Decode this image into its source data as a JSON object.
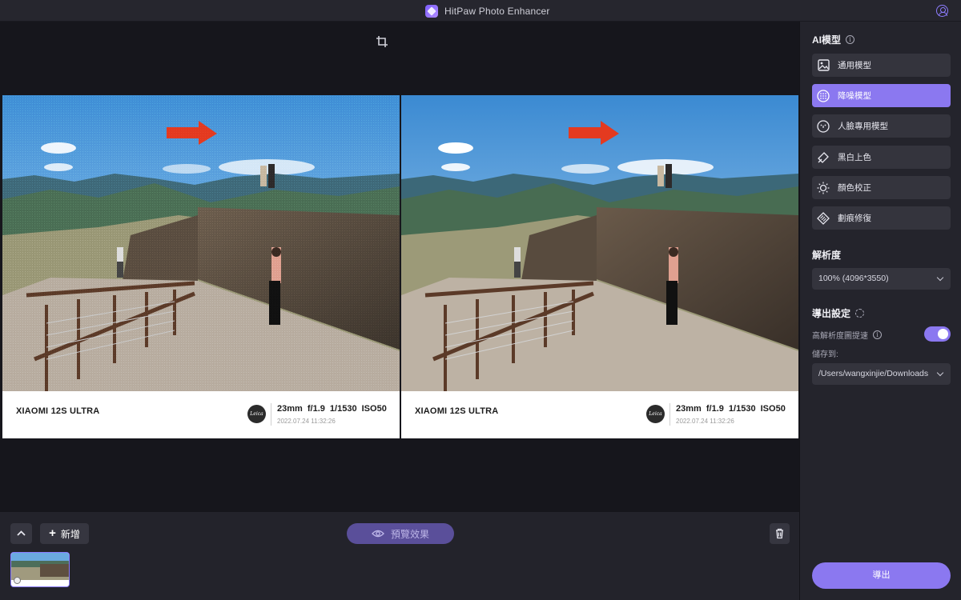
{
  "window": {
    "title": "HitPaw Photo Enhancer"
  },
  "photo": {
    "model": "XIAOMI 12S ULTRA",
    "brand_logo": "Leica",
    "specs": "23mm  f/1.9  1/1530  ISO50",
    "date": "2022.07.24 11:32:26"
  },
  "bottom": {
    "add_label": "新增",
    "preview_label": "預覽效果"
  },
  "panel": {
    "ai_model_title": "AI模型",
    "models": [
      {
        "label": "通用模型",
        "icon": "image-icon",
        "active": false
      },
      {
        "label": "降噪模型",
        "icon": "denoise-icon",
        "active": true
      },
      {
        "label": "人臉專用模型",
        "icon": "face-icon",
        "active": false
      },
      {
        "label": "黑白上色",
        "icon": "colorize-icon",
        "active": false
      },
      {
        "label": "顏色校正",
        "icon": "brightness-icon",
        "active": false
      },
      {
        "label": "劃痕修復",
        "icon": "scratch-repair-icon",
        "active": false
      }
    ],
    "resolution_title": "解析度",
    "resolution_value": "100% (4096*3550)",
    "export_settings_title": "導出設定",
    "hires_label": "高解析度圖提速",
    "hires_enabled": true,
    "save_to_label": "儲存到:",
    "save_path": "/Users/wangxinjie/Downloads",
    "export_label": "導出"
  },
  "colors": {
    "accent": "#8b78f0",
    "panel_bg": "#24242c",
    "canvas_bg": "#16161c"
  }
}
